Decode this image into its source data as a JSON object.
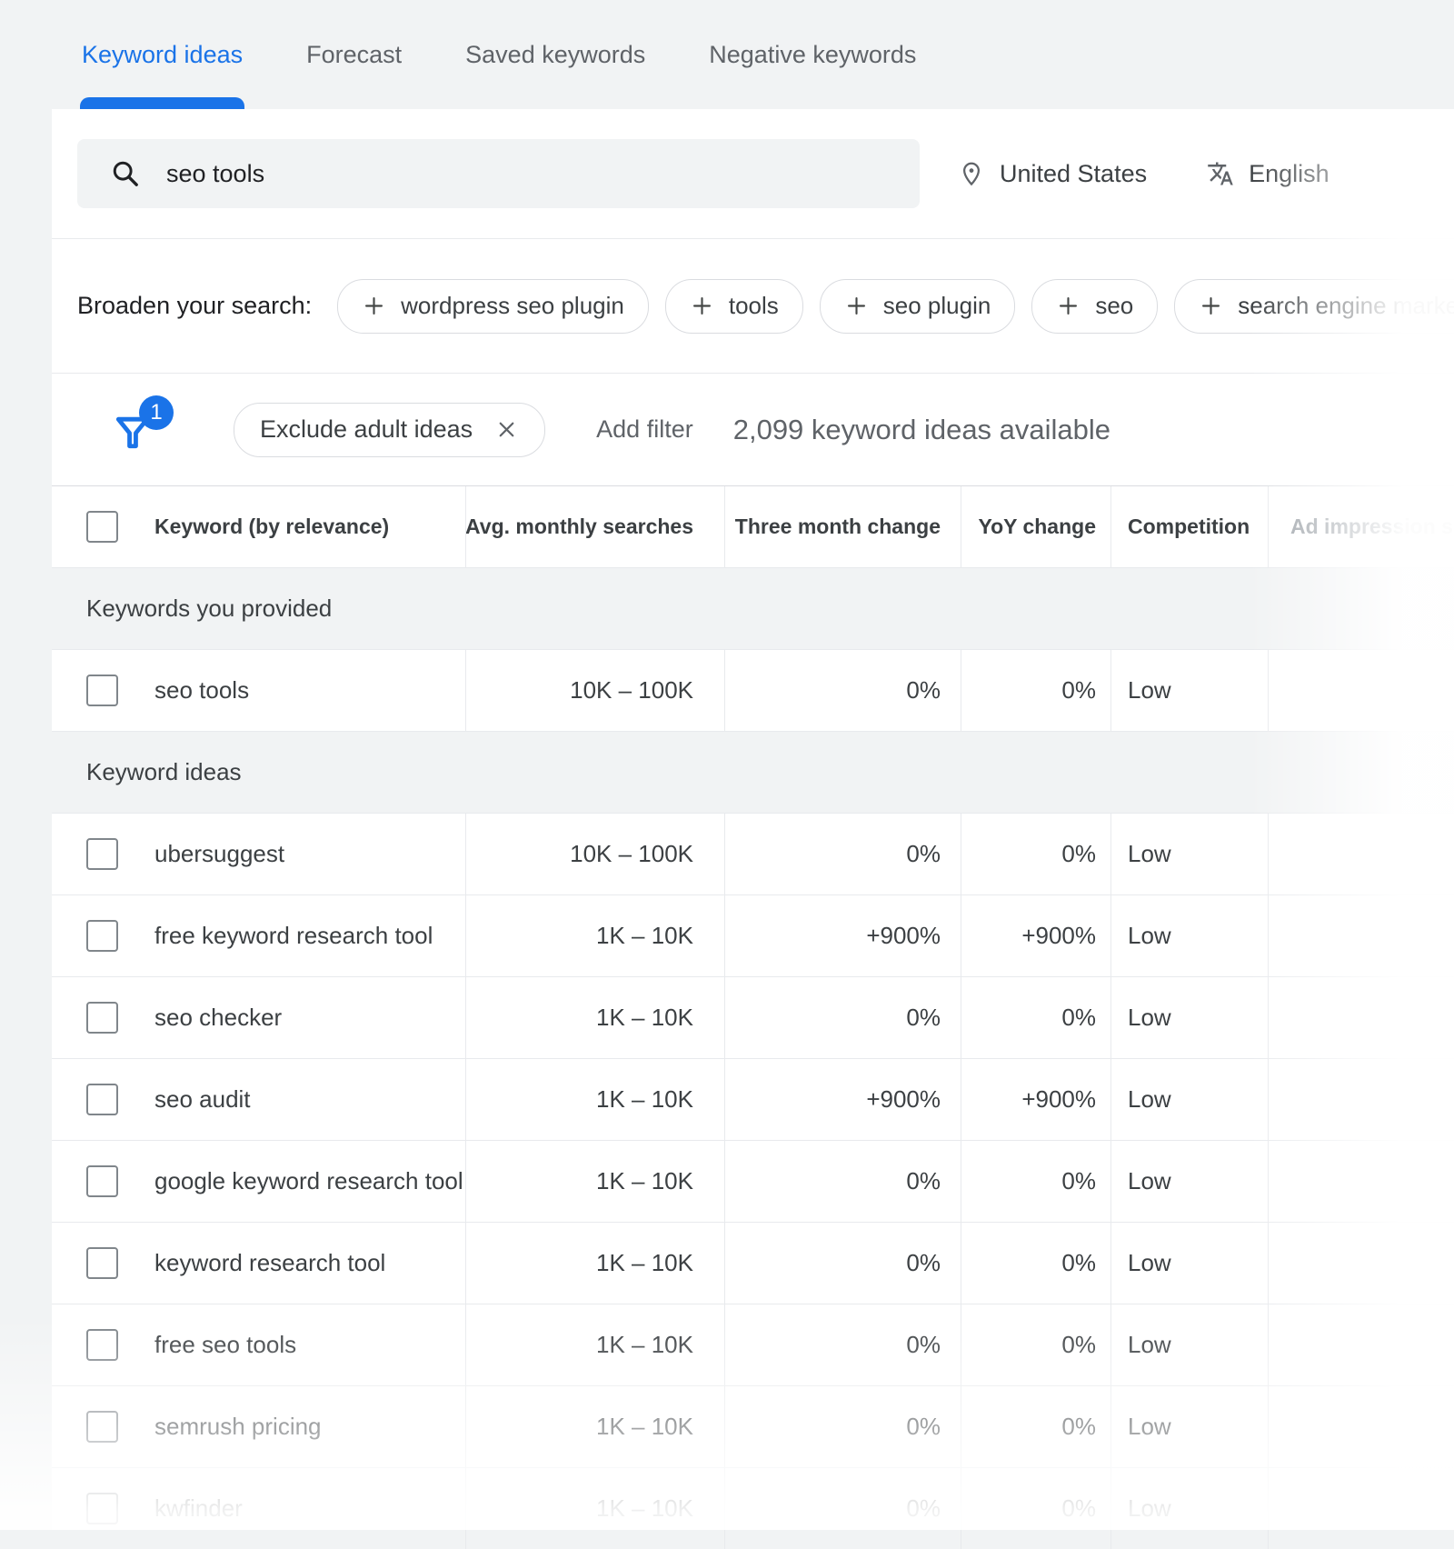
{
  "colors": {
    "accent": "#1a73e8"
  },
  "tabs": [
    {
      "label": "Keyword ideas",
      "active": true
    },
    {
      "label": "Forecast",
      "active": false
    },
    {
      "label": "Saved keywords",
      "active": false
    },
    {
      "label": "Negative keywords",
      "active": false
    }
  ],
  "search": {
    "query": "seo tools"
  },
  "location": {
    "label": "United States"
  },
  "language": {
    "label": "English"
  },
  "broaden": {
    "label": "Broaden your search:",
    "chips": [
      "wordpress seo plugin",
      "tools",
      "seo plugin",
      "seo",
      "search engine marketing"
    ]
  },
  "filters": {
    "badge_count": "1",
    "active_filter": "Exclude adult ideas",
    "add_filter_label": "Add filter",
    "results_summary": "2,099 keyword ideas available"
  },
  "table": {
    "columns": [
      "Keyword (by relevance)",
      "Avg. monthly searches",
      "Three month change",
      "YoY change",
      "Competition",
      "Ad impression share"
    ],
    "sections": [
      {
        "title": "Keywords you provided",
        "rows": [
          {
            "keyword": "seo tools",
            "avg_monthly_searches": "10K – 100K",
            "three_month_change": "0%",
            "yoy_change": "0%",
            "competition": "Low"
          }
        ]
      },
      {
        "title": "Keyword ideas",
        "rows": [
          {
            "keyword": "ubersuggest",
            "avg_monthly_searches": "10K – 100K",
            "three_month_change": "0%",
            "yoy_change": "0%",
            "competition": "Low"
          },
          {
            "keyword": "free keyword research tool",
            "avg_monthly_searches": "1K – 10K",
            "three_month_change": "+900%",
            "yoy_change": "+900%",
            "competition": "Low"
          },
          {
            "keyword": "seo checker",
            "avg_monthly_searches": "1K – 10K",
            "three_month_change": "0%",
            "yoy_change": "0%",
            "competition": "Low"
          },
          {
            "keyword": "seo audit",
            "avg_monthly_searches": "1K – 10K",
            "three_month_change": "+900%",
            "yoy_change": "+900%",
            "competition": "Low"
          },
          {
            "keyword": "google keyword research tool",
            "avg_monthly_searches": "1K – 10K",
            "three_month_change": "0%",
            "yoy_change": "0%",
            "competition": "Low"
          },
          {
            "keyword": "keyword research tool",
            "avg_monthly_searches": "1K – 10K",
            "three_month_change": "0%",
            "yoy_change": "0%",
            "competition": "Low"
          },
          {
            "keyword": "free seo tools",
            "avg_monthly_searches": "1K – 10K",
            "three_month_change": "0%",
            "yoy_change": "0%",
            "competition": "Low"
          },
          {
            "keyword": "semrush pricing",
            "avg_monthly_searches": "1K – 10K",
            "three_month_change": "0%",
            "yoy_change": "0%",
            "competition": "Low"
          },
          {
            "keyword": "kwfinder",
            "avg_monthly_searches": "1K – 10K",
            "three_month_change": "0%",
            "yoy_change": "0%",
            "competition": "Low"
          }
        ]
      }
    ]
  }
}
